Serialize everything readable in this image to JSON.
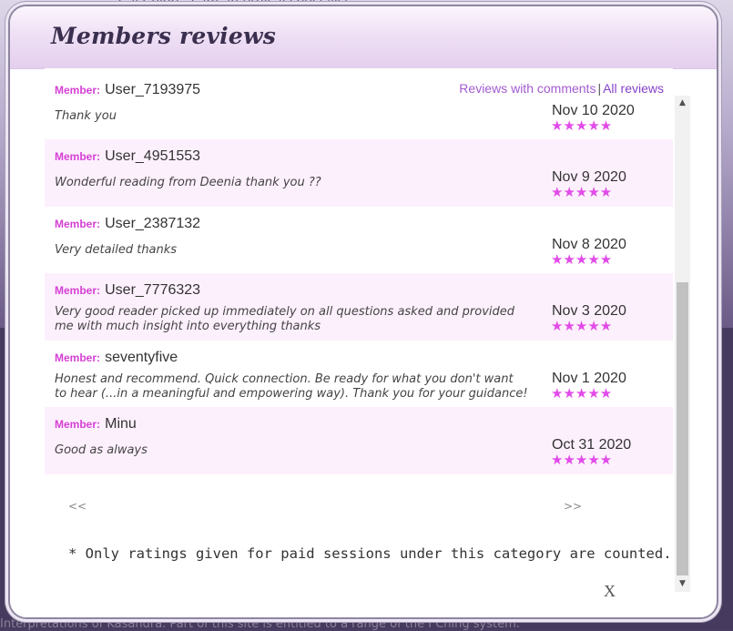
{
  "background": {
    "top_text": "Cal Colors. I am an ethical specialist",
    "bottom_text": "Interpretations of Kasandra. Part of this site is entitled to a range of the I Ching system."
  },
  "modal": {
    "title": "Members reviews",
    "filter": {
      "with_comments": "Reviews with comments",
      "separator": "|",
      "all": "All reviews"
    },
    "member_label": "Member:",
    "reviews": [
      {
        "member": "User_7193975",
        "comment": "Thank you",
        "date": "Nov 10 2020",
        "stars": "★★★★★",
        "rating": 5
      },
      {
        "member": "User_4951553",
        "comment": "Wonderful reading from Deenia thank you ??",
        "date": "Nov 9 2020",
        "stars": "★★★★★",
        "rating": 5
      },
      {
        "member": "User_2387132",
        "comment": "Very detailed thanks",
        "date": "Nov 8 2020",
        "stars": "★★★★★",
        "rating": 5
      },
      {
        "member": "User_7776323",
        "comment": "Very good reader picked up immediately on all questions asked and provided me with much insight into everything thanks",
        "date": "Nov 3 2020",
        "stars": "★★★★★",
        "rating": 5
      },
      {
        "member": "seventyfive",
        "comment": "Honest and recommend. Quick connection. Be ready for what you don't want to hear (...in a meaningful and empowering way). Thank you for your guidance!",
        "date": "Nov 1 2020",
        "stars": "★★★★★",
        "rating": 5
      },
      {
        "member": "Minu",
        "comment": "Good as always",
        "date": "Oct 31 2020",
        "stars": "★★★★★",
        "rating": 5
      }
    ],
    "pager": {
      "prev": "<<",
      "next": ">>"
    },
    "footnote": "* Only ratings given for paid sessions under this category are counted.",
    "close_label": "X"
  },
  "scrollbar": {
    "up_icon": "▲",
    "down_icon": "▼"
  },
  "colors": {
    "accent": "#a35bd0",
    "member_tag": "#d540d5",
    "stars": "#e14be8",
    "row_alt": "#fdf0fd"
  }
}
